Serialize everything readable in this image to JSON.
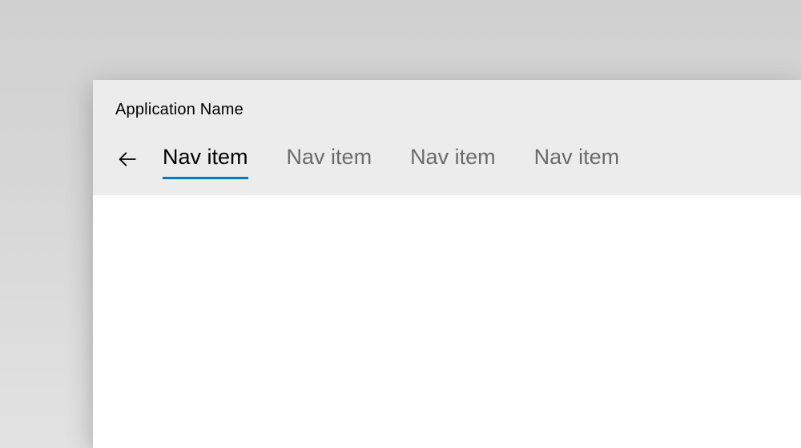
{
  "app": {
    "title": "Application Name"
  },
  "nav": {
    "items": [
      {
        "label": "Nav item",
        "active": true
      },
      {
        "label": "Nav item",
        "active": false
      },
      {
        "label": "Nav item",
        "active": false
      },
      {
        "label": "Nav item",
        "active": false
      }
    ]
  },
  "colors": {
    "accent": "#0078d4",
    "header_bg": "#ececec",
    "inactive_text": "#6b6b6b"
  }
}
